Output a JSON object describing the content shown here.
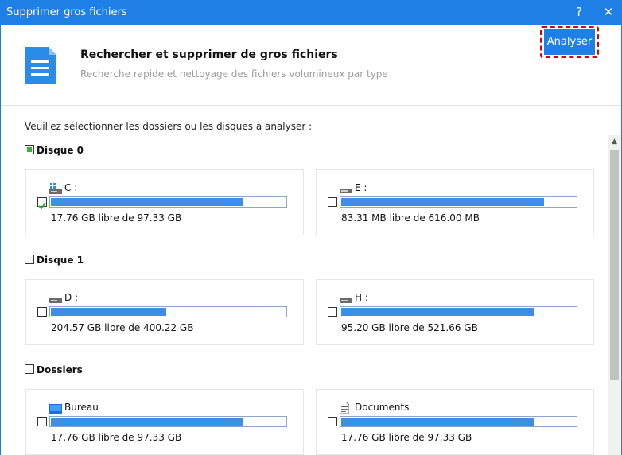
{
  "window": {
    "title": "Supprimer gros fichiers",
    "help": "?",
    "close": "✕"
  },
  "header": {
    "title": "Rechercher et supprimer de gros fichiers",
    "subtitle": "Recherche rapide et nettoyage des fichiers volumineux par type",
    "analyze_label": "Analyser"
  },
  "prompt": "Veuillez sélectionner les dossiers ou les disques à analyser :",
  "sections": [
    {
      "label": "Disque 0",
      "check_state": "partial",
      "items": [
        {
          "name": "C :",
          "icon": "system-drive-icon",
          "checked": true,
          "fill_fraction": 0.82,
          "info": "17.76 GB libre de 97.33 GB"
        },
        {
          "name": "E :",
          "icon": "drive-icon",
          "checked": false,
          "fill_fraction": 0.865,
          "info": "83.31 MB libre de 616.00 MB"
        }
      ]
    },
    {
      "label": "Disque 1",
      "check_state": "unchecked",
      "items": [
        {
          "name": "D :",
          "icon": "drive-icon",
          "checked": false,
          "fill_fraction": 0.49,
          "info": "204.57 GB libre de 400.22 GB"
        },
        {
          "name": "H :",
          "icon": "drive-icon",
          "checked": false,
          "fill_fraction": 0.82,
          "info": "95.20 GB libre de 521.66 GB"
        }
      ]
    },
    {
      "label": "Dossiers",
      "check_state": "unchecked",
      "items": [
        {
          "name": "Bureau",
          "icon": "desktop-folder-icon",
          "checked": false,
          "fill_fraction": 0.82,
          "info": "17.76 GB libre de 97.33 GB"
        },
        {
          "name": "Documents",
          "icon": "documents-folder-icon",
          "checked": false,
          "fill_fraction": 0.82,
          "info": "17.76 GB libre de 97.33 GB"
        }
      ]
    }
  ],
  "colors": {
    "accent": "#1e7fe6",
    "bar_fill": "#3d8fe6",
    "highlight": "#e00000",
    "check": "#3cb23c"
  }
}
